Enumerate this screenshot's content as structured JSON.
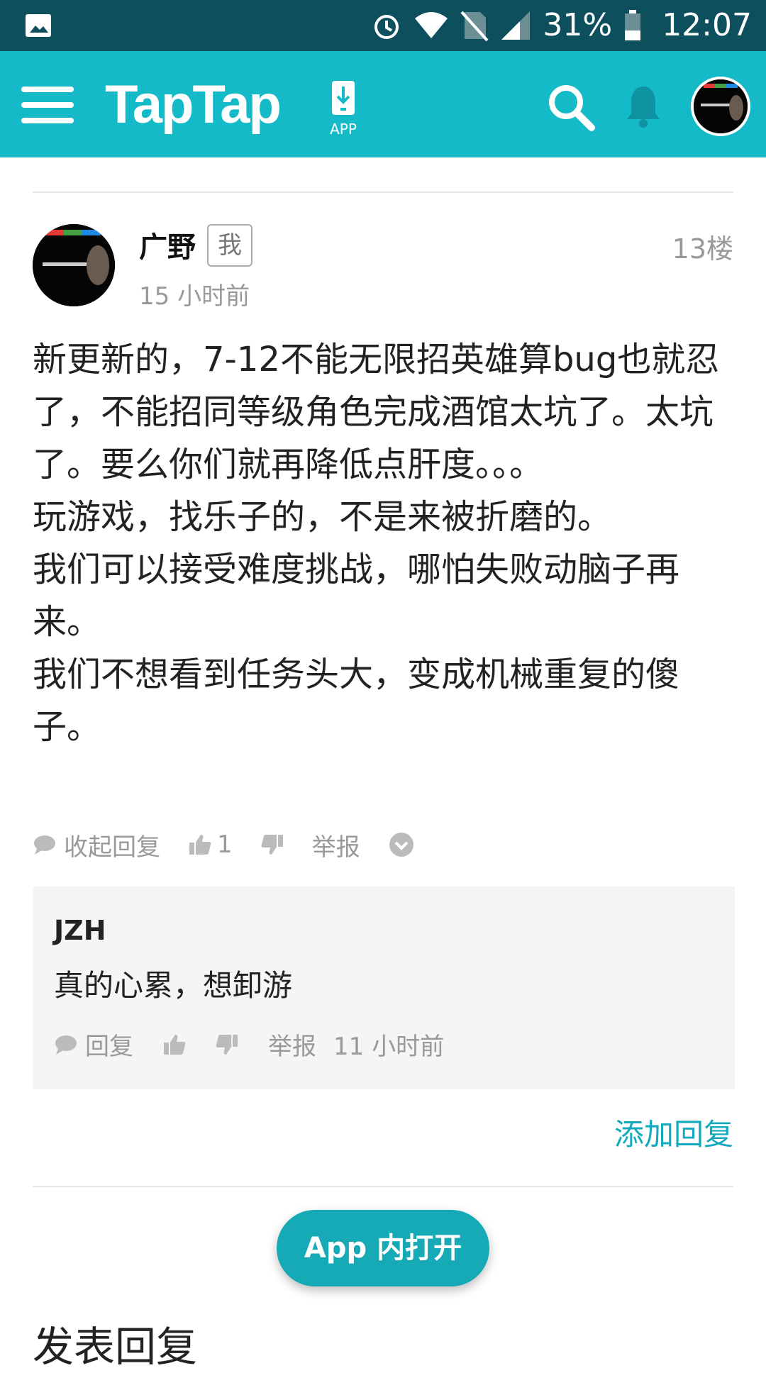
{
  "status_bar": {
    "battery": "31%",
    "time": "12:07",
    "icons": [
      "image-icon",
      "alarm-icon",
      "wifi-icon",
      "no-sim-icon",
      "signal-icon",
      "battery-icon"
    ]
  },
  "header": {
    "brand": "TapTap",
    "app_label": "APP",
    "icons": [
      "menu-icon",
      "download-app-icon",
      "search-icon",
      "bell-icon",
      "user-avatar"
    ],
    "color": "#15bac9"
  },
  "post": {
    "author": "广野",
    "me_badge": "我",
    "floor": "13楼",
    "time_ago": "15 小时前",
    "body": [
      "新更新的，7-12不能无限招英雄算bug也就忍了，不能招同等级角色完成酒馆太坑了。太坑了。要么你们就再降低点肝度。。。",
      "玩游戏，找乐子的，不是来被折磨的。",
      "我们可以接受难度挑战，哪怕失败动脑子再来。",
      "我们不想看到任务头大，变成机械重复的傻子。"
    ],
    "actions": {
      "collapse_replies": "收起回复",
      "like_count": "1",
      "report": "举报"
    }
  },
  "reply": {
    "author": "JZH",
    "text": "真的心累，想卸游",
    "actions": {
      "reply": "回复",
      "report": "举报",
      "time_ago": "11 小时前"
    }
  },
  "add_reply": "添加回复",
  "open_in_app": "App 内打开",
  "publish_reply_title": "发表回复",
  "accent_color": "#15a9bd"
}
